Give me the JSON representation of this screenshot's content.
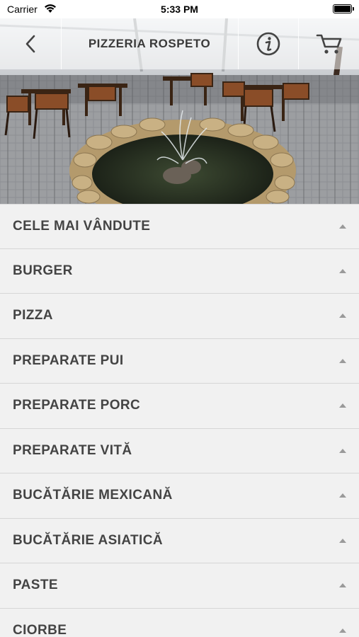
{
  "status": {
    "carrier": "Carrier",
    "time": "5:33 PM"
  },
  "nav": {
    "title": "PIZZERIA ROSPETO"
  },
  "hero": {
    "image": "restaurant-terrace-fountain-photo"
  },
  "menu": {
    "items": [
      {
        "label": "CELE MAI VÂNDUTE"
      },
      {
        "label": "BURGER"
      },
      {
        "label": "PIZZA"
      },
      {
        "label": "PREPARATE PUI"
      },
      {
        "label": "PREPARATE PORC"
      },
      {
        "label": "PREPARATE VITĂ"
      },
      {
        "label": "BUCĂTĂRIE MEXICANĂ"
      },
      {
        "label": "BUCĂTĂRIE ASIATICĂ"
      },
      {
        "label": "PASTE"
      },
      {
        "label": "CIORBE"
      }
    ]
  },
  "icons": {
    "back": "chevron-left-icon",
    "info": "info-icon",
    "cart": "cart-icon",
    "caret": "caret-up-icon"
  }
}
